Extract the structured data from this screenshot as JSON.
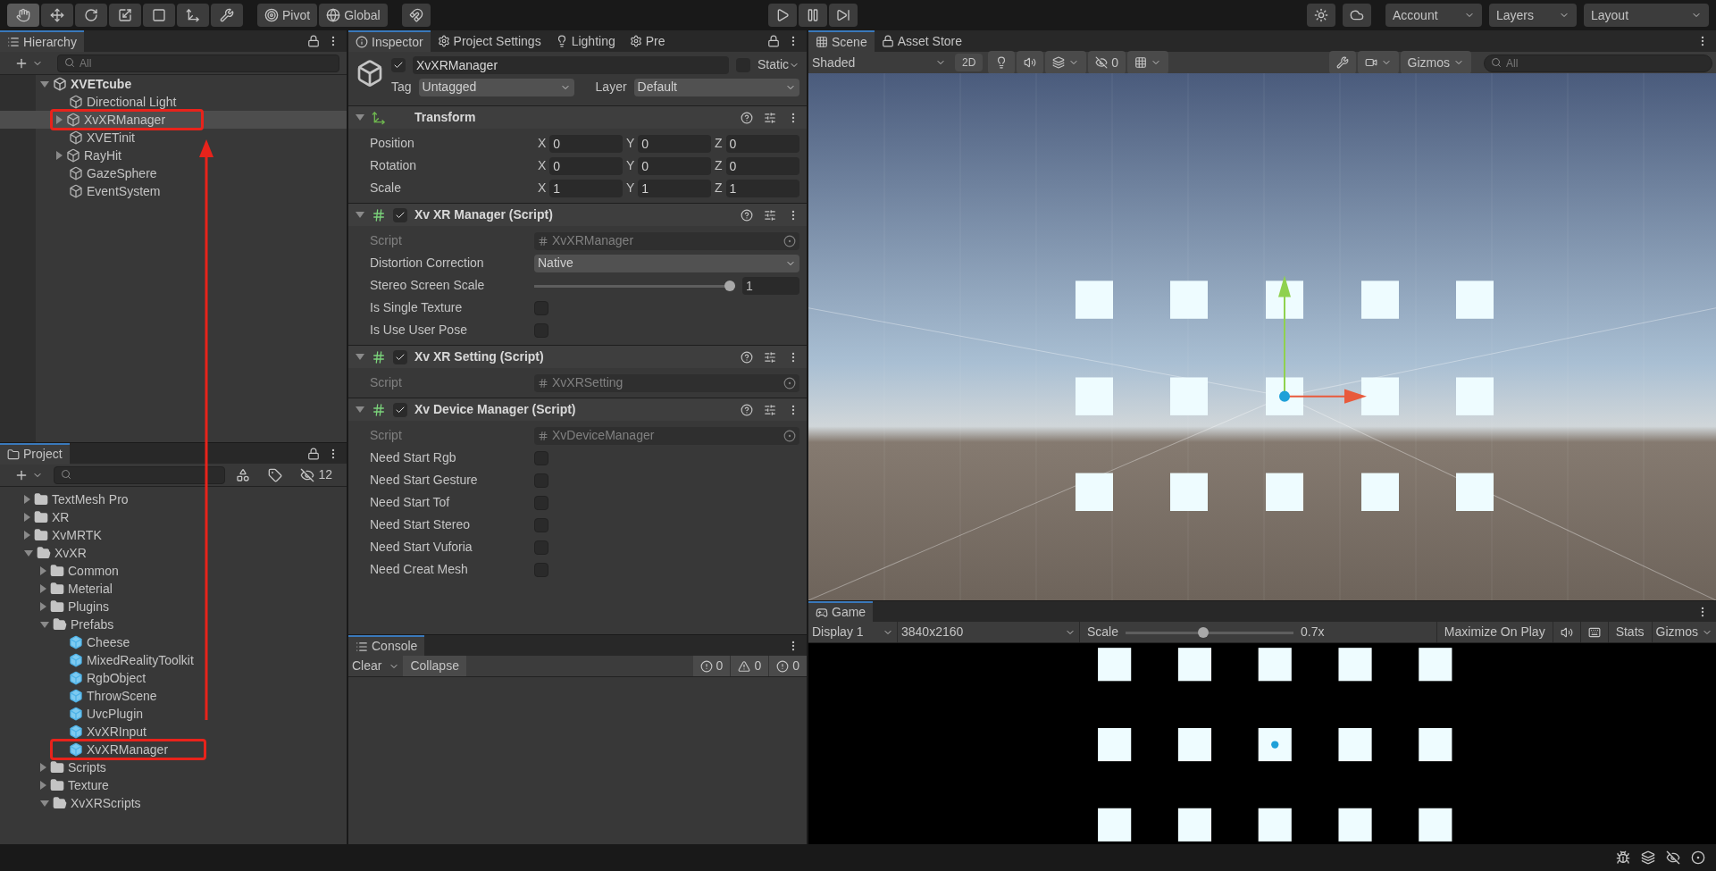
{
  "toolbar": {
    "tools": [
      {
        "kind": "hand",
        "selected": true
      },
      {
        "kind": "move",
        "selected": false
      },
      {
        "kind": "rotate",
        "selected": false
      },
      {
        "kind": "scale",
        "selected": false
      },
      {
        "kind": "rect",
        "selected": false
      },
      {
        "kind": "transform",
        "selected": false
      },
      {
        "kind": "custom",
        "selected": false
      }
    ],
    "pivot": "Pivot",
    "global": "Global",
    "account": "Account",
    "layers": "Layers",
    "layout": "Layout"
  },
  "hierarchy": {
    "title": "Hierarchy",
    "search": {
      "placeholder": "All"
    },
    "tree": [
      {
        "name": "XVETcube",
        "kind": "scene",
        "expanded": true,
        "selected": false,
        "annotated": false,
        "children": [
          {
            "name": "Directional Light",
            "kind": "object",
            "selected": false,
            "annotated": false
          },
          {
            "name": "XvXRManager",
            "kind": "object",
            "expanded": false,
            "selected": true,
            "annotated": true
          },
          {
            "name": "XVETinit",
            "kind": "object",
            "selected": false,
            "annotated": false
          },
          {
            "name": "RayHit",
            "kind": "object",
            "expanded": false,
            "selected": false,
            "annotated": false
          },
          {
            "name": "GazeSphere",
            "kind": "object",
            "selected": false,
            "annotated": false
          },
          {
            "name": "EventSystem",
            "kind": "object",
            "selected": false,
            "annotated": false
          }
        ]
      }
    ]
  },
  "project": {
    "title": "Project",
    "hidden_count": "12",
    "tree": [
      {
        "name": "TextMesh Pro",
        "kind": "folder",
        "expanded": false,
        "annotated": false
      },
      {
        "name": "XR",
        "kind": "folder",
        "expanded": false,
        "annotated": false
      },
      {
        "name": "XvMRTK",
        "kind": "folder",
        "expanded": false,
        "annotated": false
      },
      {
        "name": "XvXR",
        "kind": "folder",
        "expanded": true,
        "annotated": false,
        "children": [
          {
            "name": "Common",
            "kind": "folder",
            "expanded": false,
            "annotated": false
          },
          {
            "name": "Meterial",
            "kind": "folder",
            "expanded": false,
            "annotated": false
          },
          {
            "name": "Plugins",
            "kind": "folder",
            "expanded": false,
            "annotated": false
          },
          {
            "name": "Prefabs",
            "kind": "folder",
            "expanded": true,
            "annotated": false,
            "children": [
              {
                "name": "Cheese",
                "kind": "prefab",
                "annotated": false
              },
              {
                "name": "MixedRealityToolkit",
                "kind": "prefab",
                "annotated": false
              },
              {
                "name": "RgbObject",
                "kind": "prefab",
                "annotated": false
              },
              {
                "name": "ThrowScene",
                "kind": "prefab",
                "annotated": false
              },
              {
                "name": "UvcPlugin",
                "kind": "prefab",
                "annotated": false
              },
              {
                "name": "XvXRInput",
                "kind": "prefab",
                "annotated": false
              },
              {
                "name": "XvXRManager",
                "kind": "prefab",
                "annotated": true
              }
            ]
          },
          {
            "name": "Scripts",
            "kind": "folder",
            "expanded": false,
            "annotated": false
          },
          {
            "name": "Texture",
            "kind": "folder",
            "expanded": false,
            "annotated": false
          },
          {
            "name": "XvXRScripts",
            "kind": "folder",
            "expanded": true,
            "annotated": false
          }
        ]
      }
    ]
  },
  "inspector": {
    "tabs": [
      {
        "label": "Inspector",
        "selected": true
      },
      {
        "label": "Project Settings",
        "selected": false
      },
      {
        "label": "Lighting",
        "selected": false
      },
      {
        "label": "Pre",
        "selected": false
      }
    ],
    "object": {
      "name": "XvXRManager",
      "active": true,
      "static_label": "Static",
      "static": false,
      "tag_label": "Tag",
      "tag": "Untagged",
      "layer_label": "Layer",
      "layer": "Default"
    },
    "transform": {
      "title": "Transform",
      "rows": [
        {
          "label": "Position",
          "values": [
            {
              "axis": "X",
              "value": "0"
            },
            {
              "axis": "Y",
              "value": "0"
            },
            {
              "axis": "Z",
              "value": "0"
            }
          ]
        },
        {
          "label": "Rotation",
          "values": [
            {
              "axis": "X",
              "value": "0"
            },
            {
              "axis": "Y",
              "value": "0"
            },
            {
              "axis": "Z",
              "value": "0"
            }
          ]
        },
        {
          "label": "Scale",
          "values": [
            {
              "axis": "X",
              "value": "1"
            },
            {
              "axis": "Y",
              "value": "1"
            },
            {
              "axis": "Z",
              "value": "1"
            }
          ]
        }
      ]
    },
    "components": [
      {
        "title": "Xv XR Manager (Script)",
        "enabled": true,
        "fields": [
          {
            "kind": "object",
            "label": "Script",
            "value": "XvXRManager"
          },
          {
            "kind": "dropdown",
            "label": "Distortion Correction",
            "value": "Native"
          },
          {
            "kind": "slider",
            "label": "Stereo Screen Scale",
            "level": 1,
            "value": "1"
          },
          {
            "kind": "checkbox",
            "label": "Is Single Texture",
            "checked": false
          },
          {
            "kind": "checkbox",
            "label": "Is Use User Pose",
            "checked": false
          }
        ]
      },
      {
        "title": "Xv XR Setting (Script)",
        "enabled": true,
        "fields": [
          {
            "kind": "object",
            "label": "Script",
            "value": "XvXRSetting"
          }
        ]
      },
      {
        "title": "Xv Device Manager (Script)",
        "enabled": true,
        "fields": [
          {
            "kind": "object",
            "label": "Script",
            "value": "XvDeviceManager"
          },
          {
            "kind": "checkbox",
            "label": "Need Start Rgb",
            "checked": false
          },
          {
            "kind": "checkbox",
            "label": "Need Start Gesture",
            "checked": false
          },
          {
            "kind": "checkbox",
            "label": "Need Start Tof",
            "checked": false
          },
          {
            "kind": "checkbox",
            "label": "Need Start Stereo",
            "checked": false
          },
          {
            "kind": "checkbox",
            "label": "Need Start Vuforia",
            "checked": false
          },
          {
            "kind": "checkbox",
            "label": "Need Creat Mesh",
            "checked": false
          }
        ]
      }
    ]
  },
  "console": {
    "title": "Console",
    "clear": "Clear",
    "collapse": "Collapse",
    "collapse_on": false,
    "logs": "0",
    "warnings": "0",
    "errors": "0"
  },
  "scene": {
    "tabs": [
      {
        "label": "Scene",
        "selected": true
      },
      {
        "label": "Asset Store",
        "selected": false
      }
    ],
    "shading": "Shaded",
    "mode_2d": "2D",
    "mode_2d_on": false,
    "hidden_count": "0",
    "gizmos": "Gizmos",
    "search": {
      "placeholder": "All"
    }
  },
  "game": {
    "title": "Game",
    "display": "Display 1",
    "resolution": "3840x2160",
    "scale_label": "Scale",
    "scale": {
      "level": 0.46
    },
    "scale_value": "0.7x",
    "maximize": "Maximize On Play",
    "stats": "Stats",
    "gizmos": "Gizmos"
  }
}
